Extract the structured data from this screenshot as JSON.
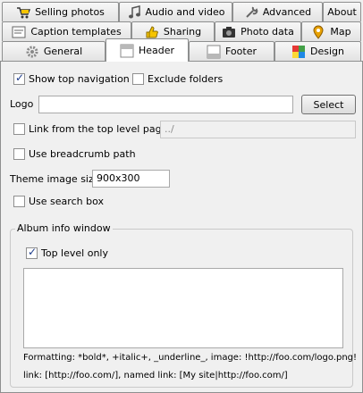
{
  "tabs_row1": [
    "Selling photos",
    "Audio and video",
    "Advanced",
    "About"
  ],
  "tabs_row2": [
    "Caption templates",
    "Sharing",
    "Photo data",
    "Map"
  ],
  "tabs_row3": [
    "General",
    "Header",
    "Footer",
    "Design"
  ],
  "active_tab": "Header",
  "header": {
    "show_top_navigation": {
      "label": "Show top navigation",
      "checked": true
    },
    "exclude_folders": {
      "label": "Exclude folders",
      "checked": false
    },
    "logo": {
      "label": "Logo",
      "value": "",
      "button": "Select"
    },
    "link_from_top": {
      "label": "Link from the top level page",
      "checked": false,
      "value": "../"
    },
    "breadcrumb": {
      "label": "Use breadcrumb path",
      "checked": false
    },
    "theme_image_size": {
      "label": "Theme image size",
      "value": "900x300"
    },
    "search_box": {
      "label": "Use search box",
      "checked": false
    },
    "album_info": {
      "title": "Album info window",
      "top_level_only": {
        "label": "Top level only",
        "checked": true
      },
      "text": "",
      "help_line1": "Formatting: *bold*, +italic+, _underline_, image: !http://foo.com/logo.png!",
      "help_line2": "link: [http://foo.com/], named link: [My site|http://foo.com/]"
    }
  }
}
